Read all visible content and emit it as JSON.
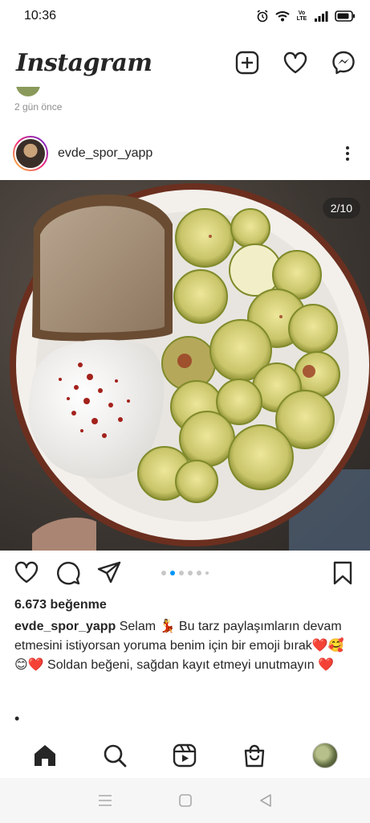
{
  "status_bar": {
    "time": "10:36",
    "network_label": "Vo LTE"
  },
  "header": {
    "app_title": "Instagram",
    "icons": [
      "new-post-icon",
      "activity-heart-icon",
      "messenger-icon"
    ]
  },
  "previous_post": {
    "timestamp": "2 gün önce"
  },
  "post": {
    "username": "evde_spor_yapp",
    "carousel_counter": "2/10",
    "carousel_index": 2,
    "carousel_total": 10,
    "likes": "6.673 beğenme",
    "caption_user": "evde_spor_yapp",
    "caption_text": "Selam 💃 Bu tarz paylaşımların devam etmesini istiyorsan yoruma benim için bir emoji bırak❤️🥰 😊❤️ Soldan beğeni, sağdan kayıt etmeyi unutmayın ❤️",
    "more_dot": "•",
    "action_icons": [
      "like-heart-icon",
      "comment-icon",
      "share-icon",
      "save-bookmark-icon"
    ]
  },
  "bottom_nav": {
    "items": [
      "home-icon",
      "search-icon",
      "reels-icon",
      "shop-icon",
      "profile-avatar"
    ]
  },
  "system_nav": {
    "items": [
      "menu-icon",
      "home-square-icon",
      "back-icon"
    ]
  },
  "colors": {
    "accent": "#0095f6",
    "text": "#262626",
    "muted": "#8e8e8e"
  }
}
